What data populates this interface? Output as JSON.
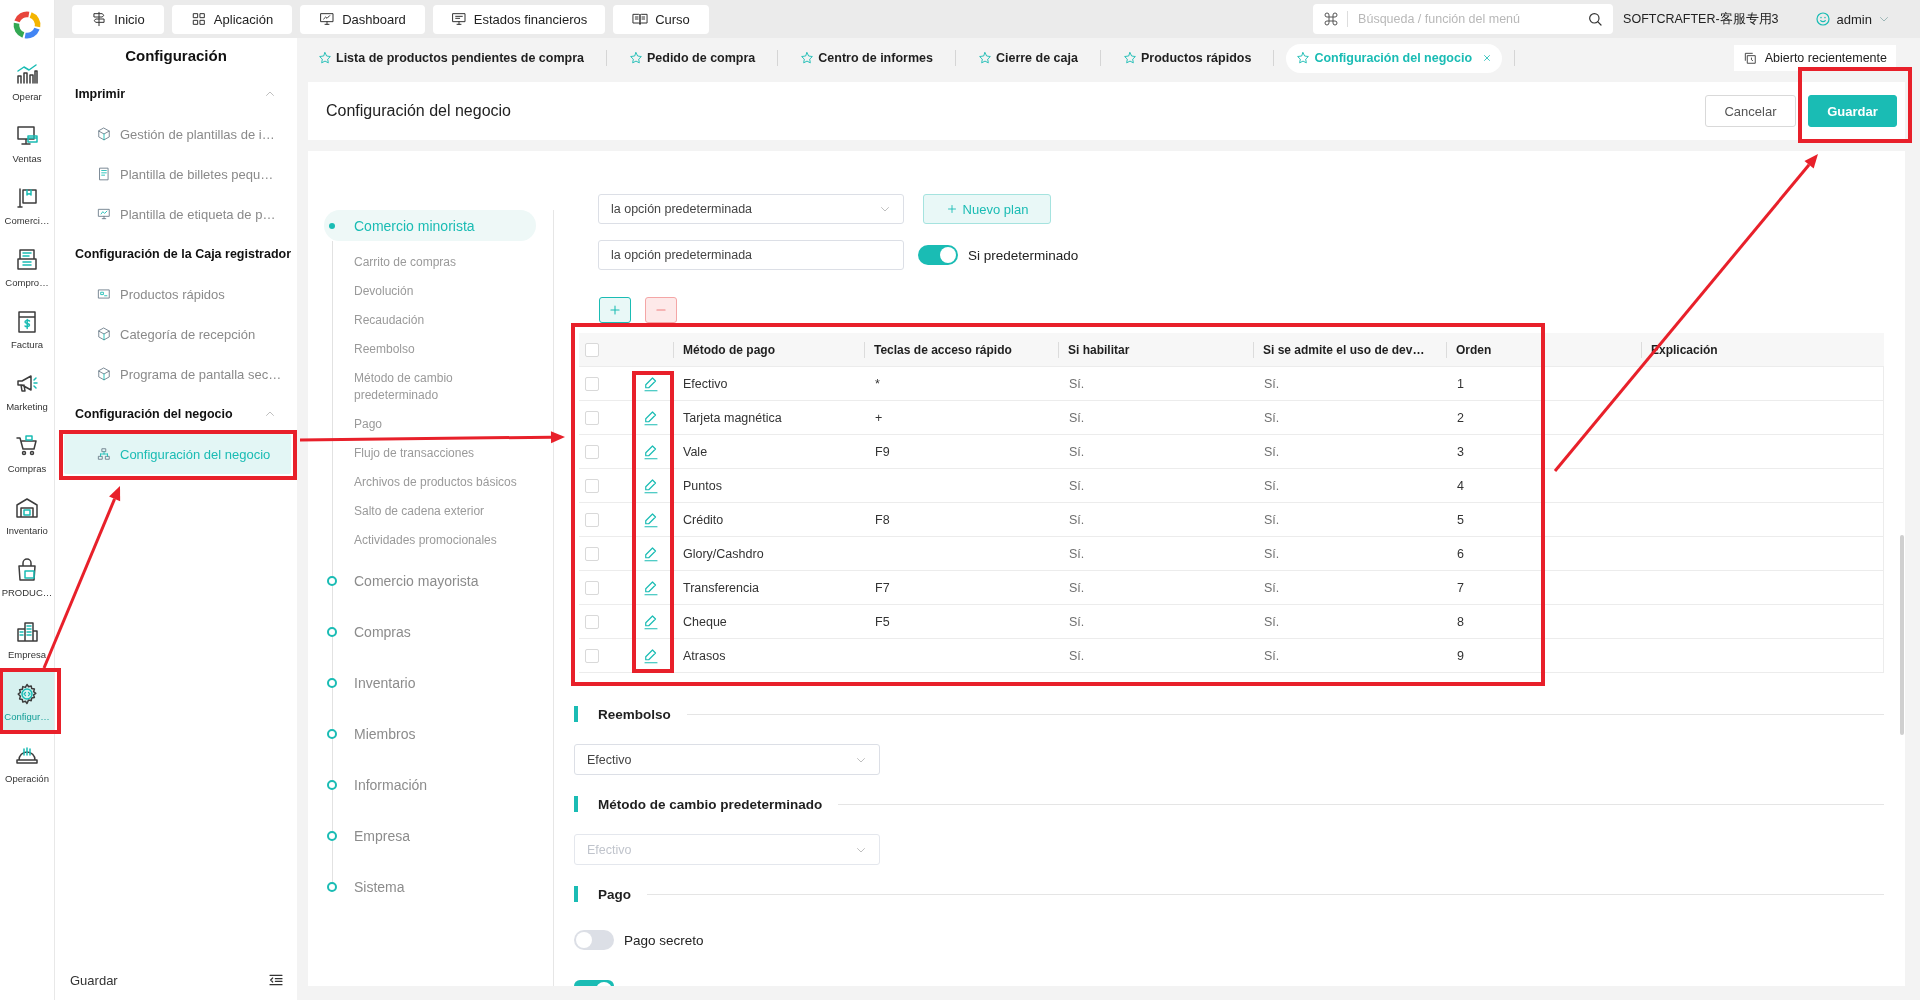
{
  "rail": {
    "items": [
      {
        "label": "Operar",
        "selected": false
      },
      {
        "label": "Ventas",
        "selected": false
      },
      {
        "label": "Comerci…",
        "selected": false
      },
      {
        "label": "Compro…",
        "selected": false
      },
      {
        "label": "Factura",
        "selected": false
      },
      {
        "label": "Marketing",
        "selected": false
      },
      {
        "label": "Compras",
        "selected": false
      },
      {
        "label": "Inventario",
        "selected": false
      },
      {
        "label": "PRODUC…",
        "selected": false
      },
      {
        "label": "Empresa",
        "selected": false
      },
      {
        "label": "Configur…",
        "selected": true
      },
      {
        "label": "Operación",
        "selected": false
      }
    ]
  },
  "top_bar": {
    "nav": [
      "Inicio",
      "Aplicación",
      "Dashboard",
      "Estados financieros",
      "Curso"
    ],
    "search": {
      "placeholder": "Búsqueda / función del menú"
    },
    "account": "SOFTCRAFTER-客服专用3",
    "user": "admin"
  },
  "menu": {
    "title": "Configuración",
    "groups": [
      {
        "label": "Imprimir",
        "expanded": true,
        "items": [
          {
            "label": "Gestión de plantillas de i…",
            "selected": false
          },
          {
            "label": "Plantilla de billetes pequ…",
            "selected": false
          },
          {
            "label": "Plantilla de etiqueta de p…",
            "selected": false
          }
        ]
      },
      {
        "label": "Configuración de la Caja registrador",
        "items": [
          {
            "label": "Productos rápidos",
            "selected": false
          },
          {
            "label": "Categoría de recepción",
            "selected": false
          },
          {
            "label": "Programa de pantalla sec…",
            "selected": false
          }
        ]
      },
      {
        "label": "Configuración del negocio",
        "expanded": true,
        "items": [
          {
            "label": "Configuración del negocio",
            "selected": true
          }
        ]
      }
    ],
    "footer": "Guardar"
  },
  "tabs": {
    "items": [
      {
        "label": "Lista de productos pendientes de compra",
        "selected": false
      },
      {
        "label": "Pedido de compra",
        "selected": false
      },
      {
        "label": "Centro de informes",
        "selected": false
      },
      {
        "label": "Cierre de caja",
        "selected": false
      },
      {
        "label": "Productos rápidos",
        "selected": false
      },
      {
        "label": "Configuración del negocio",
        "selected": true
      }
    ],
    "recent": "Abierto recientemente"
  },
  "header": {
    "title": "Configuración del negocio",
    "buttons": [
      {
        "label": "Cancelar",
        "kind": "default"
      },
      {
        "label": "Guardar",
        "kind": "primary"
      }
    ]
  },
  "settings_nav": [
    {
      "label": "Comercio minorista",
      "selected": true,
      "children": [
        {
          "label": "Carrito de compras",
          "selected": false
        },
        {
          "label": "Devolución",
          "selected": false
        },
        {
          "label": "Recaudación",
          "selected": false
        },
        {
          "label": "Reembolso",
          "selected": false
        },
        {
          "label": "Método de cambio predeterminado",
          "selected": false
        },
        {
          "label": "Pago",
          "selected": false
        },
        {
          "label": "Flujo de transacciones",
          "selected": false
        },
        {
          "label": "Archivos de productos básicos",
          "selected": false
        },
        {
          "label": "Salto de cadena exterior",
          "selected": false
        },
        {
          "label": "Actividades promocionales",
          "selected": false
        }
      ]
    },
    {
      "label": "Comercio mayorista",
      "selected": false
    },
    {
      "label": "Compras",
      "selected": false
    },
    {
      "label": "Inventario",
      "selected": false
    },
    {
      "label": "Miembros",
      "selected": false
    },
    {
      "label": "Información",
      "selected": false
    },
    {
      "label": "Empresa",
      "selected": false
    },
    {
      "label": "Sistema",
      "selected": false
    }
  ],
  "plan": {
    "select": {
      "value": "la opción predeterminada"
    },
    "new_button": "Nuevo plan",
    "name_field": {
      "value": "la opción predeterminada"
    },
    "default_toggle": {
      "label": "Si predeterminado",
      "on": true
    }
  },
  "payment_table": {
    "all_checked": false,
    "columns": [
      "Método de pago",
      "Teclas de acceso rápido",
      "Si habilitar",
      "Si se admite el uso de dev…",
      "Orden",
      "Explicación"
    ],
    "rows": [
      {
        "checked": false,
        "method": "Efectivo",
        "hotkey": "*",
        "enabled": "Sí.",
        "returns": "Sí.",
        "order": "1"
      },
      {
        "checked": false,
        "method": "Tarjeta magnética",
        "hotkey": "+",
        "enabled": "Sí.",
        "returns": "Sí.",
        "order": "2"
      },
      {
        "checked": false,
        "method": "Vale",
        "hotkey": "F9",
        "enabled": "Sí.",
        "returns": "Sí.",
        "order": "3"
      },
      {
        "checked": false,
        "method": "Puntos",
        "enabled": "Sí.",
        "returns": "Sí.",
        "order": "4"
      },
      {
        "checked": false,
        "method": "Crédito",
        "hotkey": "F8",
        "enabled": "Sí.",
        "returns": "Sí.",
        "order": "5"
      },
      {
        "checked": false,
        "method": "Glory/Cashdro",
        "enabled": "Sí.",
        "returns": "Sí.",
        "order": "6"
      },
      {
        "checked": false,
        "method": "Transferencia",
        "hotkey": "F7",
        "enabled": "Sí.",
        "returns": "Sí.",
        "order": "7"
      },
      {
        "checked": false,
        "method": "Cheque",
        "hotkey": "F5",
        "enabled": "Sí.",
        "returns": "Sí.",
        "order": "8"
      },
      {
        "checked": false,
        "method": "Atrasos",
        "enabled": "Sí.",
        "returns": "Sí.",
        "order": "9"
      }
    ]
  },
  "sections": [
    {
      "title": "Reembolso",
      "kind": "select",
      "value": "Efectivo",
      "disabled": false
    },
    {
      "title": "Método de cambio predeterminado",
      "kind": "select",
      "value": "Efectivo",
      "disabled": true
    },
    {
      "title": "Pago",
      "kind": "toggles",
      "toggles": [
        {
          "label": "Pago secreto",
          "on": false
        },
        {
          "on": true
        }
      ]
    }
  ]
}
